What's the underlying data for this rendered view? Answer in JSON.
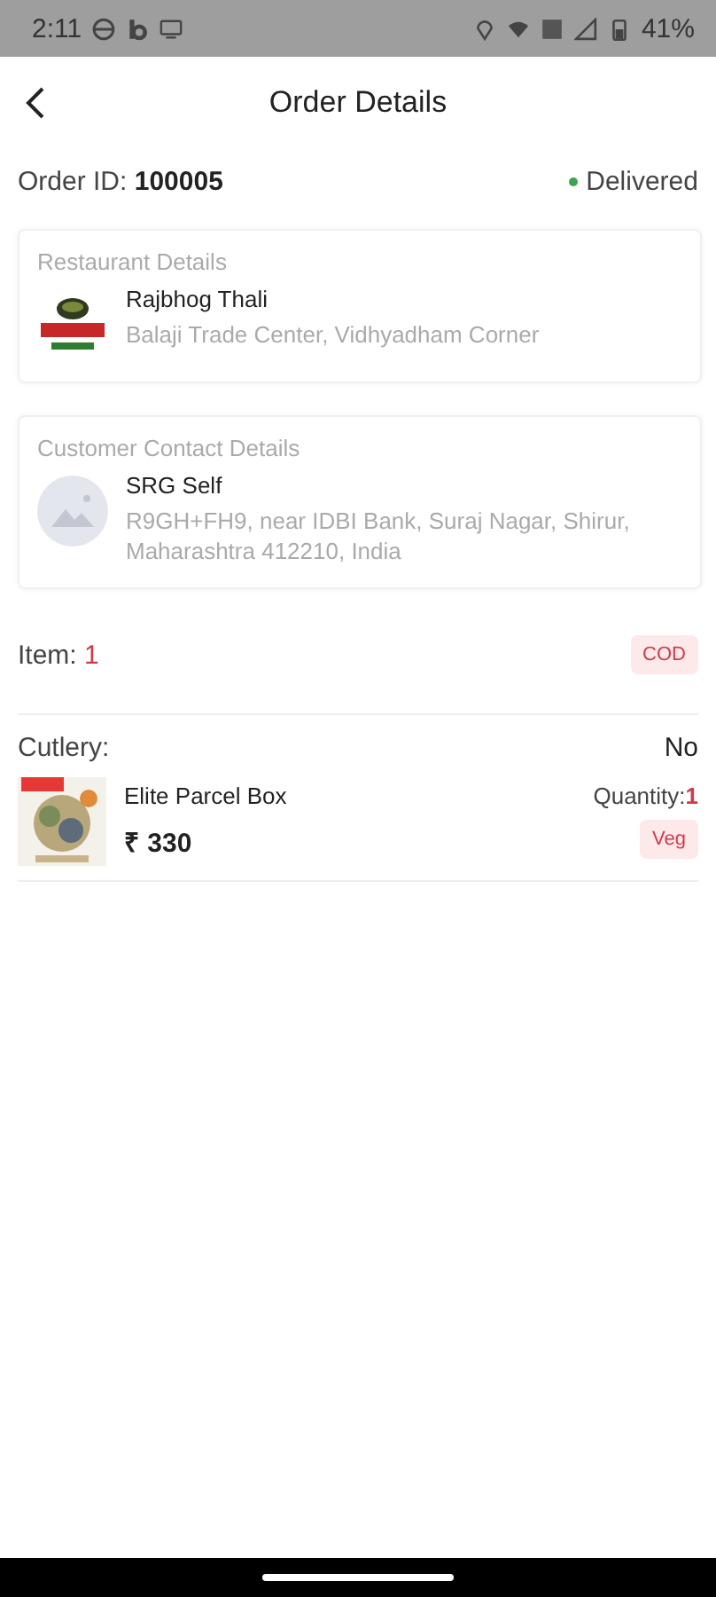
{
  "status_bar": {
    "time": "2:11",
    "battery": "41%"
  },
  "header": {
    "title": "Order Details"
  },
  "order": {
    "label": "Order ID:",
    "id": "100005",
    "status": "Delivered"
  },
  "restaurant": {
    "heading": "Restaurant Details",
    "name": "Rajbhog Thali",
    "address": "Balaji Trade Center, Vidhyadham Corner"
  },
  "customer": {
    "heading": "Customer Contact Details",
    "name": "SRG Self",
    "address": "R9GH+FH9, near IDBI Bank, Suraj Nagar, Shirur, Maharashtra 412210, India"
  },
  "items_summary": {
    "label": "Item:",
    "count": "1",
    "payment": "COD"
  },
  "cutlery": {
    "label": "Cutlery:",
    "value": "No"
  },
  "items": [
    {
      "name": "Elite Parcel Box",
      "price": "₹ 330",
      "quantity_label": "Quantity:",
      "quantity": "1",
      "tag": "Veg"
    }
  ]
}
